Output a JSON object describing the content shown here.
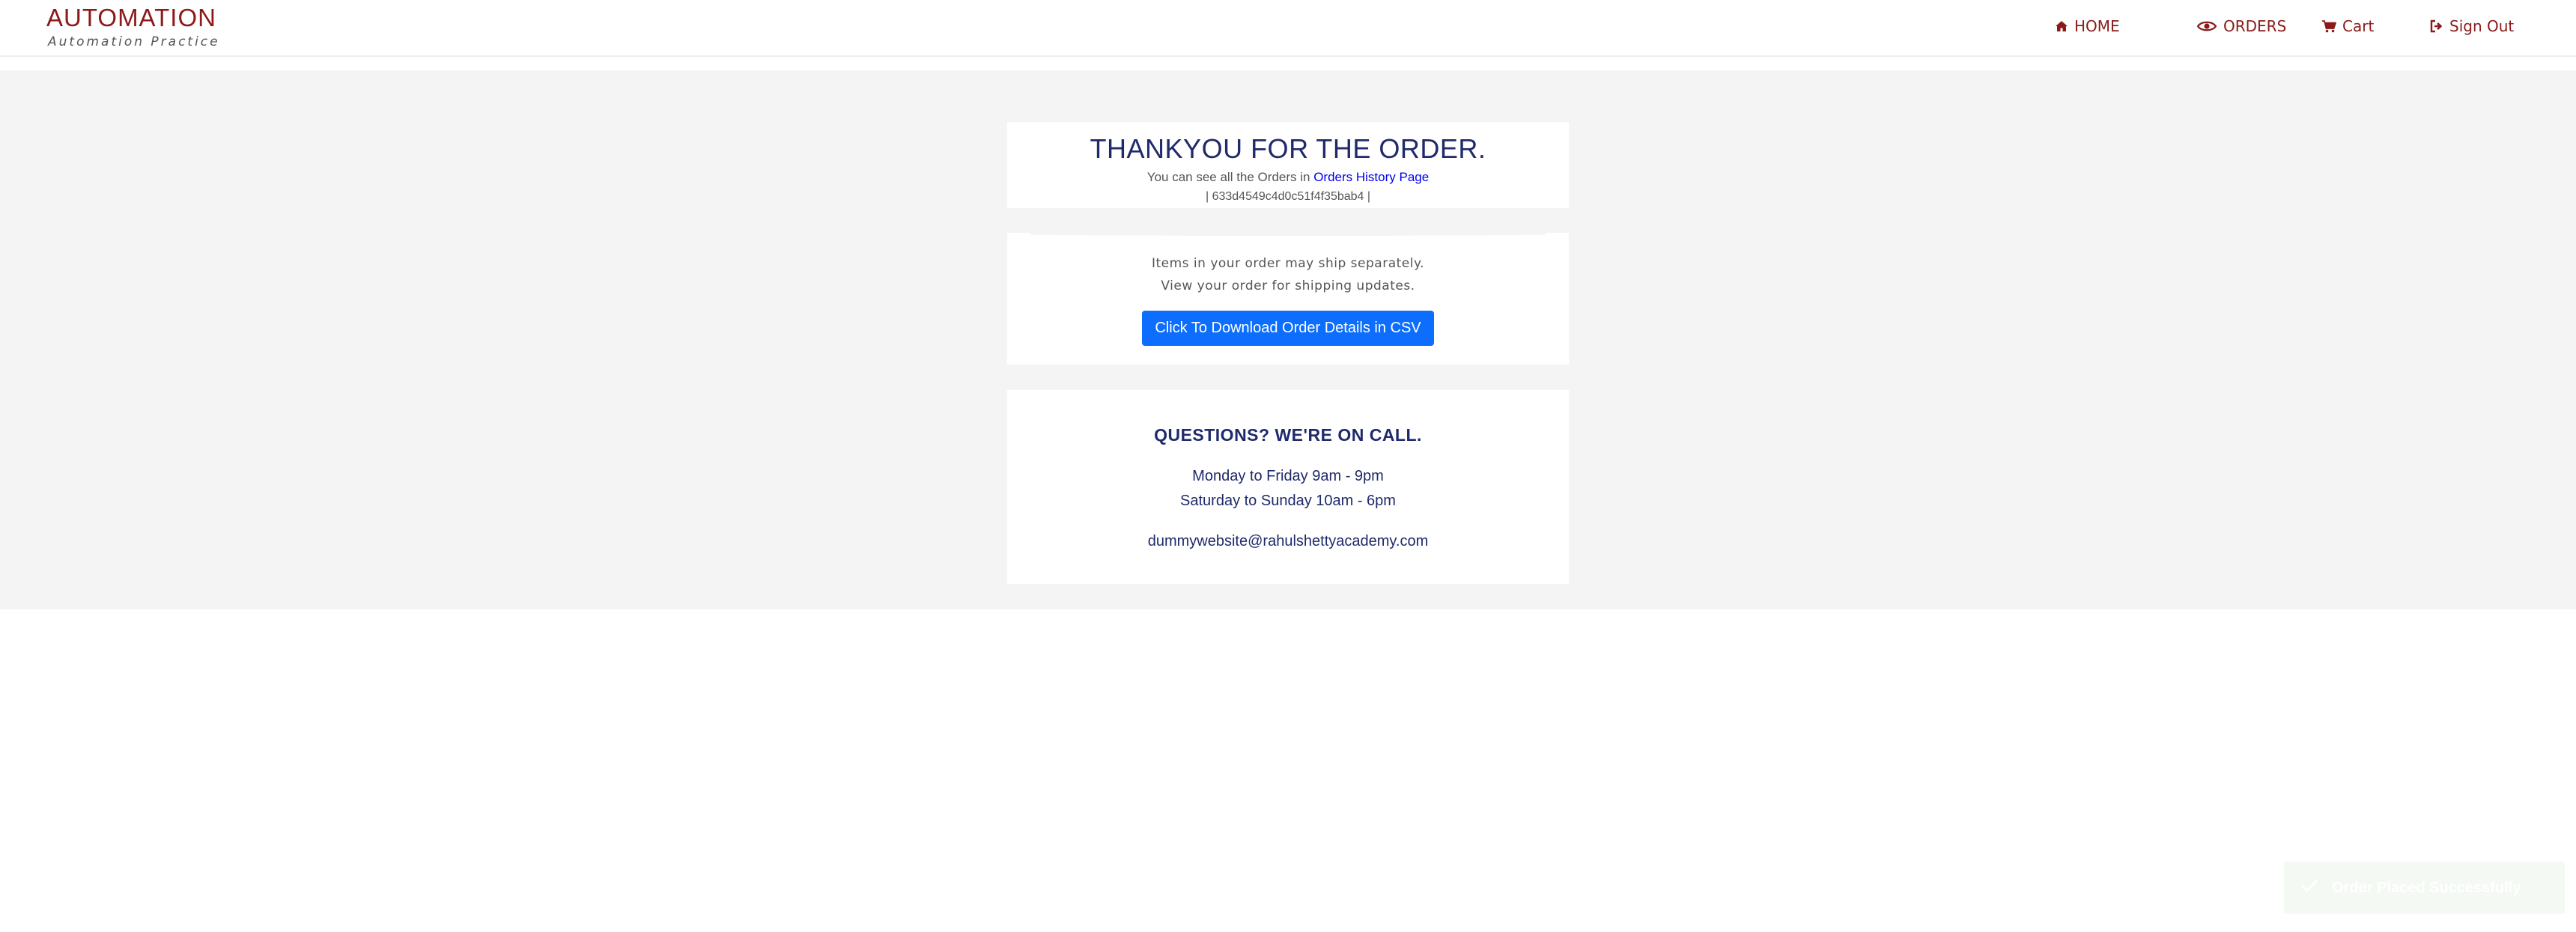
{
  "header": {
    "brand_title": "AUTOMATION",
    "brand_subtitle": "Automation Practice",
    "nav": {
      "home": {
        "label": "HOME",
        "icon": "home-icon"
      },
      "orders": {
        "label": "ORDERS",
        "icon": "eye-icon"
      },
      "cart": {
        "label": "Cart",
        "icon": "cart-icon"
      },
      "signout": {
        "label": "Sign Out",
        "icon": "sign-out-icon"
      }
    }
  },
  "thanks": {
    "title": "THANKYOU FOR THE ORDER.",
    "history_prefix": "You can see all the Orders in ",
    "history_link": "Orders History Page",
    "order_id": "| 633d4549c4d0c51f4f35bab4 |"
  },
  "shipping": {
    "line1": "Items in your order may ship separately.",
    "line2": "View your order for shipping updates.",
    "csv_button": "Click To Download Order Details in CSV"
  },
  "questions": {
    "title": "QUESTIONS? WE'RE ON CALL.",
    "hours_weekday": "Monday to Friday 9am - 9pm",
    "hours_weekend": "Saturday to Sunday 10am - 6pm",
    "email": "dummywebsite@rahulshettyacademy.com"
  },
  "toast": {
    "message": "Order Placed Successfully",
    "icon": "check-icon"
  },
  "colors": {
    "brand": "#8b1a1a",
    "heading": "#1f2a6b",
    "button": "#0d6efd",
    "link": "#0000ee",
    "background": "#f4f4f4"
  }
}
